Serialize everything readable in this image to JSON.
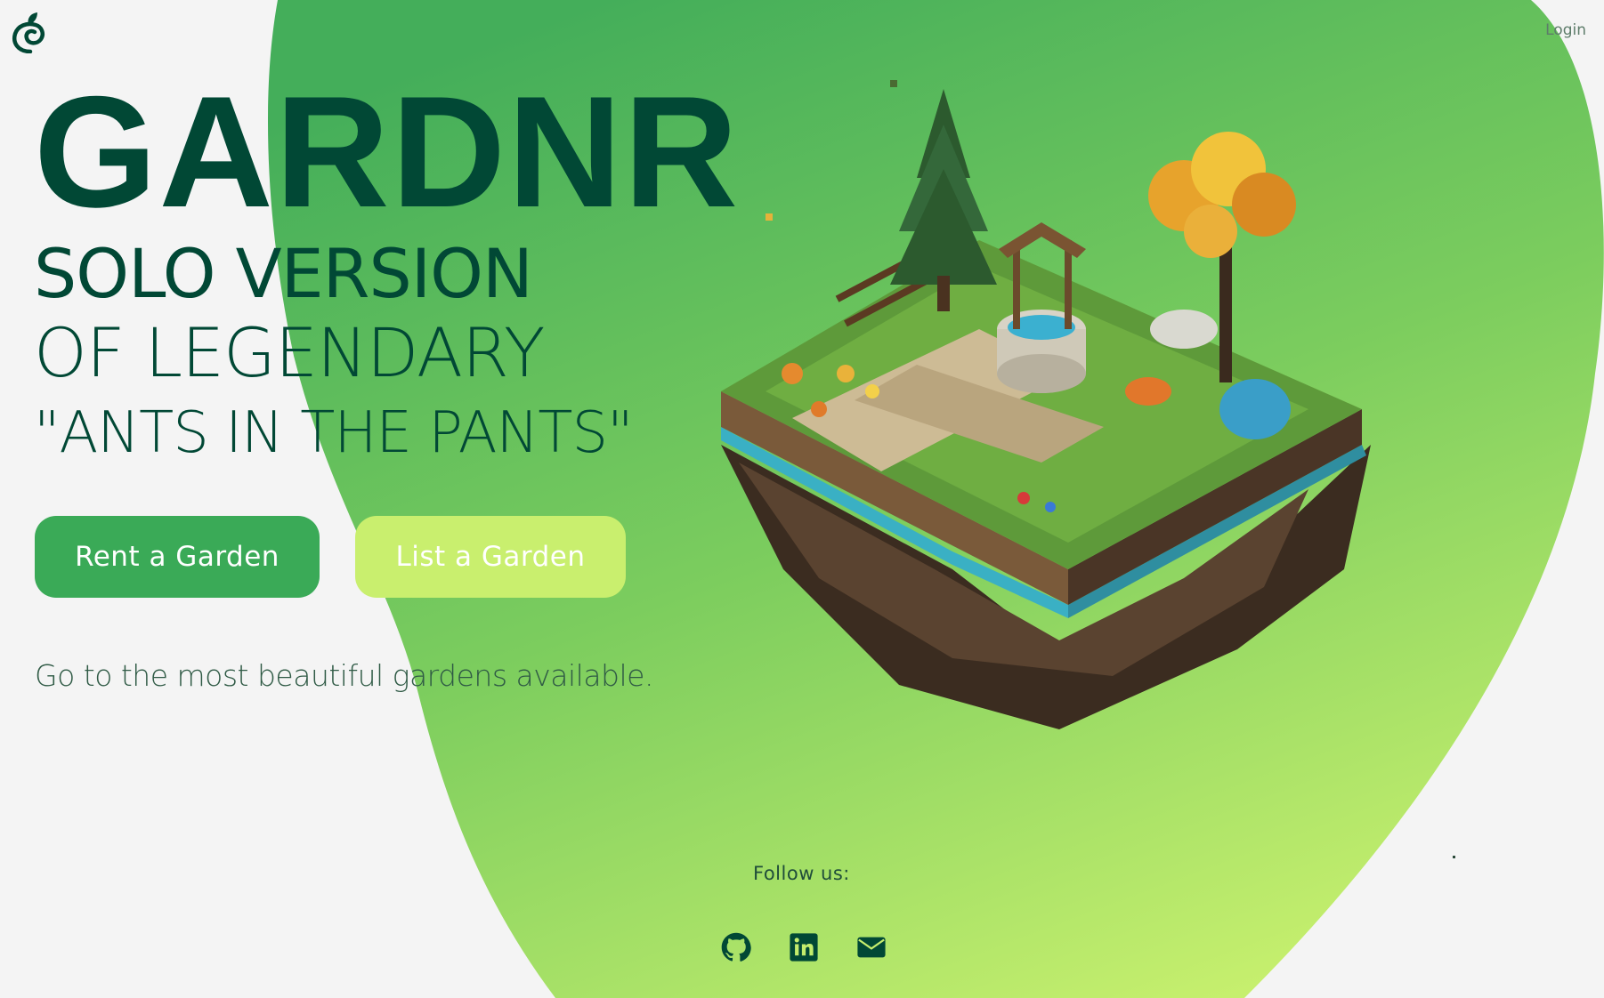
{
  "nav": {
    "login_label": "Login"
  },
  "hero": {
    "title": "GARDNR",
    "subtitle_line1": "SOLO VERSION",
    "subtitle_line2": "OF LEGENDARY",
    "subtitle_line3": "\"ANTS IN THE PANTS\""
  },
  "buttons": {
    "rent_label": "Rent a Garden",
    "list_label": "List a Garden"
  },
  "tagline": "Go to the most beautiful gardens available.",
  "footer": {
    "follow_label": "Follow us:",
    "socials": [
      "github-icon",
      "linkedin-icon",
      "email-icon"
    ]
  },
  "colors": {
    "brand_dark": "#014835",
    "primary_green": "#3aaa57",
    "accent_lime": "#c9ef6e",
    "blob_top": "#44ae5a",
    "blob_bottom": "#c8f06e",
    "background": "#f4f4f4"
  }
}
